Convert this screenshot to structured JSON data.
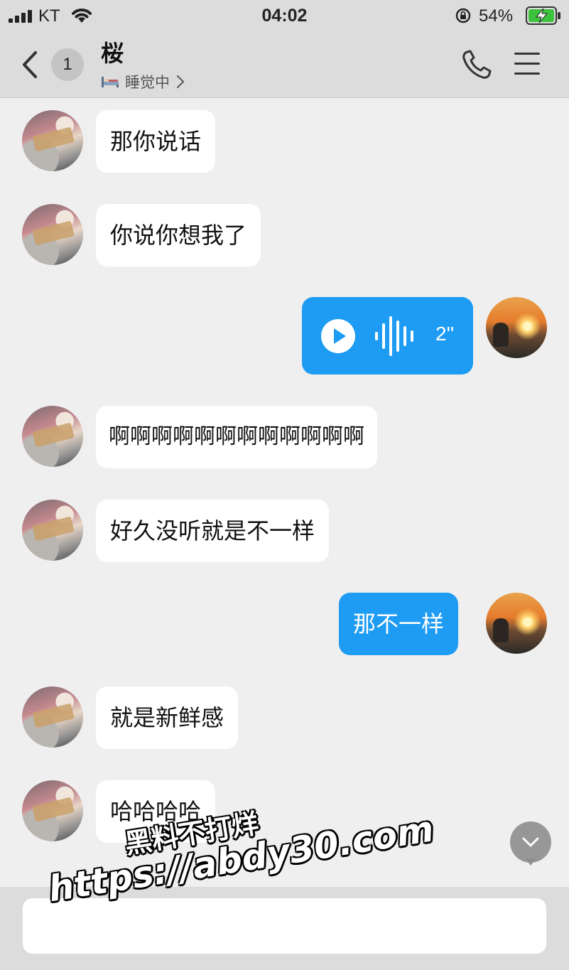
{
  "status_bar": {
    "carrier": "KT",
    "time": "04:02",
    "battery": "54%"
  },
  "header": {
    "unread_count": "1",
    "contact_name": "桜",
    "contact_status": "睡觉中"
  },
  "messages": [
    {
      "side": "in",
      "type": "text",
      "text": "那你说话"
    },
    {
      "side": "in",
      "type": "text",
      "text": "你说你想我了"
    },
    {
      "side": "out",
      "type": "voice",
      "duration": "2''"
    },
    {
      "side": "in",
      "type": "text",
      "text": "啊啊啊啊啊啊啊啊啊啊啊啊"
    },
    {
      "side": "in",
      "type": "text",
      "text": "好久没听就是不一样"
    },
    {
      "side": "out",
      "type": "text",
      "text": "那不一样"
    },
    {
      "side": "in",
      "type": "text",
      "text": "就是新鲜感"
    },
    {
      "side": "in",
      "type": "text",
      "text": "哈哈哈哈"
    }
  ],
  "input": {
    "value": "",
    "placeholder": ""
  },
  "watermark": {
    "line1": "黑料不打烊",
    "line2": "https://abdy30.com"
  },
  "colors": {
    "accent_blue": "#1e9bf3",
    "chat_background": "#efefef",
    "header_background": "#dcdcdc"
  },
  "icons": [
    "signal-icon",
    "wifi-icon",
    "orientation-lock-icon",
    "battery-charging-icon",
    "back-chevron-icon",
    "bed-icon",
    "chevron-right-icon",
    "phone-icon",
    "menu-icon",
    "play-icon",
    "voice-wave-icon",
    "chevron-down-icon"
  ]
}
